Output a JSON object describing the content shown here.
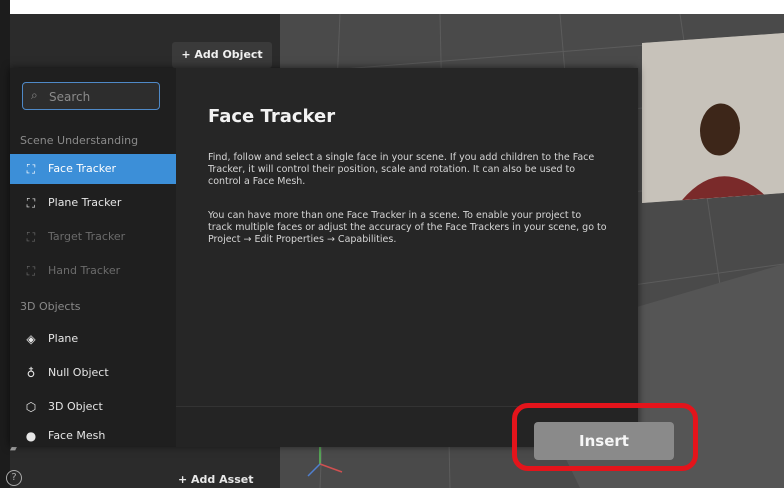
{
  "toolbar": {
    "add_object_label": "+ Add Object",
    "add_asset_label": "+ Add Asset"
  },
  "help_icon_glyph": "?",
  "dialog": {
    "search": {
      "placeholder": "Search",
      "icon": "search-icon"
    },
    "sections": [
      {
        "label": "Scene Understanding",
        "items": [
          {
            "label": "Face Tracker",
            "icon": "face-tracker-icon",
            "state": "selected"
          },
          {
            "label": "Plane Tracker",
            "icon": "plane-tracker-icon",
            "state": "enabled"
          },
          {
            "label": "Target Tracker",
            "icon": "target-tracker-icon",
            "state": "disabled"
          },
          {
            "label": "Hand Tracker",
            "icon": "hand-tracker-icon",
            "state": "disabled"
          }
        ]
      },
      {
        "label": "3D Objects",
        "items": [
          {
            "label": "Plane",
            "icon": "plane-icon",
            "state": "enabled"
          },
          {
            "label": "Null Object",
            "icon": "null-object-icon",
            "state": "enabled"
          },
          {
            "label": "3D Object",
            "icon": "3d-object-icon",
            "state": "enabled"
          },
          {
            "label": "Face Mesh",
            "icon": "face-mesh-icon",
            "state": "enabled"
          }
        ]
      }
    ],
    "content": {
      "title": "Face Tracker",
      "paragraph1": "Find, follow and select a single face in your scene. If you add children to the Face Tracker, it will control their position, scale and rotation. It can also be used to control a Face Mesh.",
      "paragraph2": "You can have more than one Face Tracker in a scene. To enable your project to track multiple faces or adjust the accuracy of the Face Trackers in your scene, go to Project → Edit Properties → Capabilities."
    },
    "insert_label": "Insert"
  },
  "colors": {
    "accent": "#3c8fd8",
    "highlight": "#e4141b"
  }
}
